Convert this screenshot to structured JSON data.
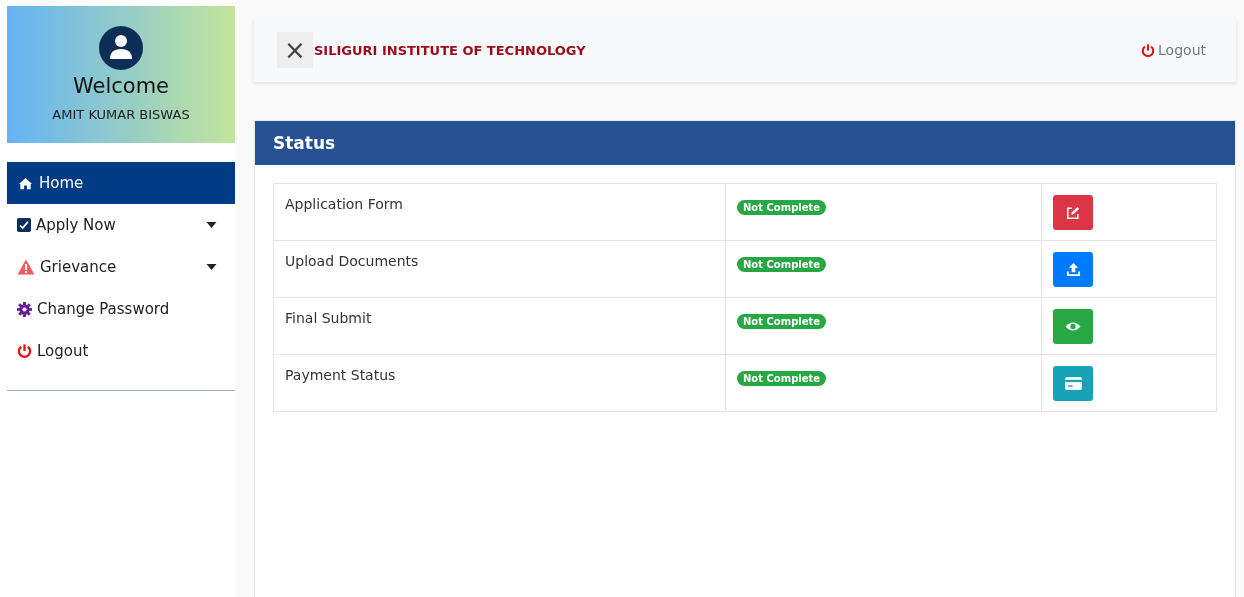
{
  "sidebar": {
    "welcome": "Welcome",
    "user_name": "AMIT KUMAR BISWAS",
    "items": [
      {
        "label": "Home",
        "kind": "home",
        "selected": true,
        "dropdown": false
      },
      {
        "label": "Apply Now",
        "kind": "check",
        "selected": false,
        "dropdown": true
      },
      {
        "label": "Grievance",
        "kind": "warning",
        "selected": false,
        "dropdown": true
      },
      {
        "label": "Change Password",
        "kind": "gear",
        "selected": false,
        "dropdown": false
      },
      {
        "label": "Logout",
        "kind": "power",
        "selected": false,
        "dropdown": false
      }
    ]
  },
  "topbar": {
    "close_icon": "×",
    "institute": "SILIGURI INSTITUTE OF TECHNOLOGY",
    "logout": "Logout"
  },
  "status": {
    "title": "Status",
    "rows": [
      {
        "task": "Application Form",
        "status": "Not Complete",
        "kind": "edit"
      },
      {
        "task": "Upload Documents",
        "status": "Not Complete",
        "kind": "upload"
      },
      {
        "task": "Final Submit",
        "status": "Not Complete",
        "kind": "view"
      },
      {
        "task": "Payment Status",
        "status": "Not Complete",
        "kind": "payment"
      }
    ]
  }
}
